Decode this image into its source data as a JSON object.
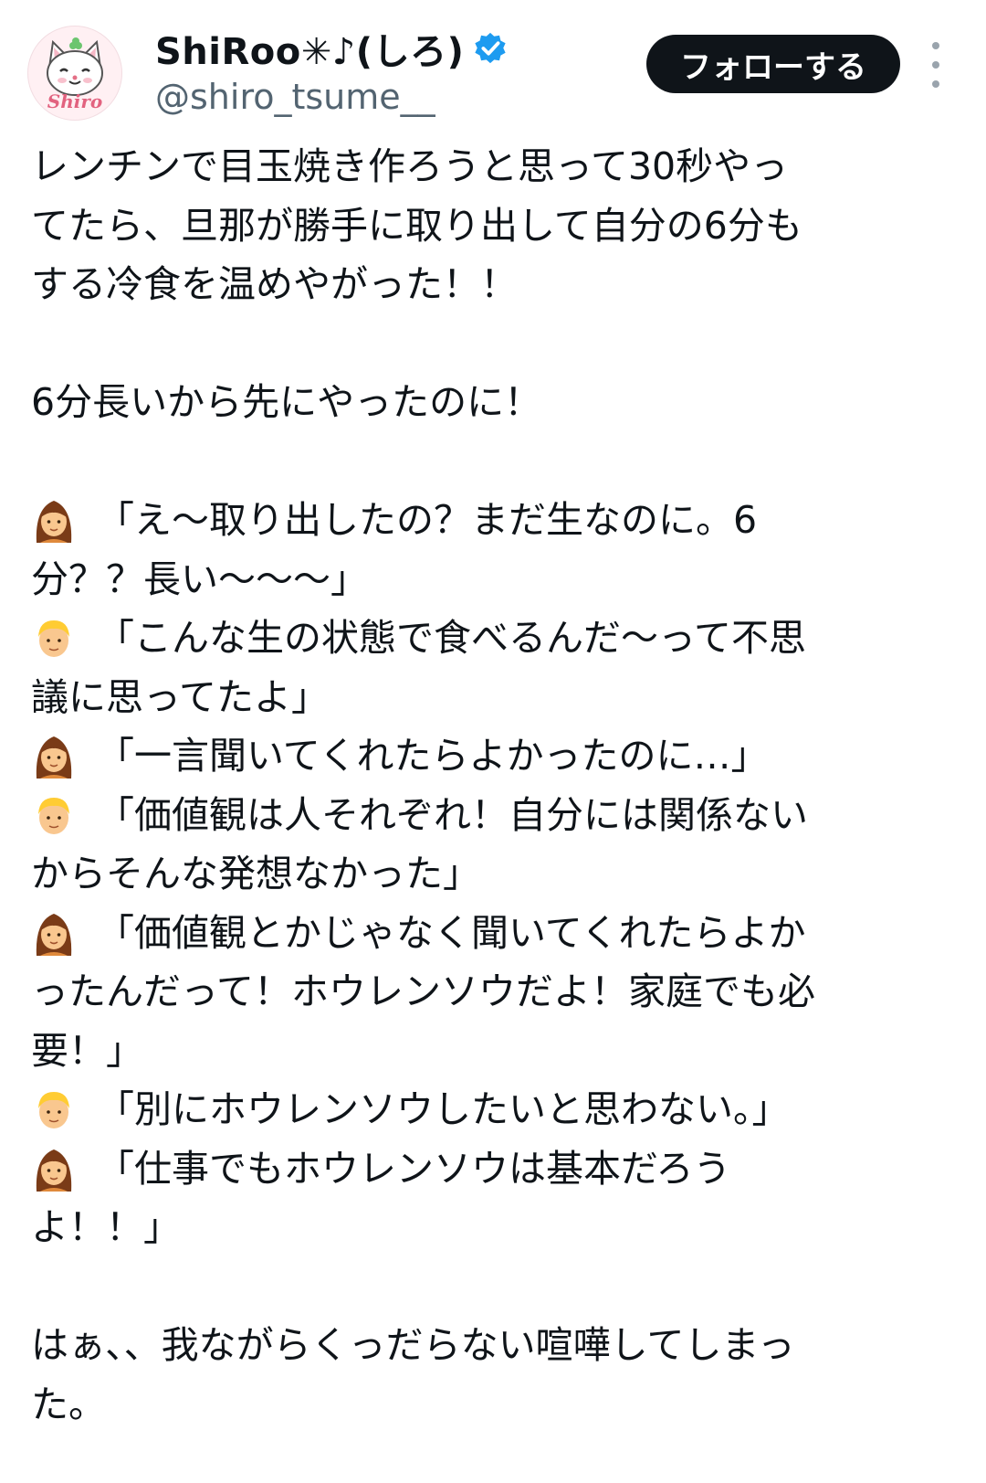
{
  "tweet": {
    "author": {
      "display_name": "ShiRoo✳♪(しろ)",
      "handle": "@shiro_tsume__",
      "avatar_text": "Shiro",
      "verified": true
    },
    "follow_label": "フォローする",
    "lines": [
      {
        "text": "レンチンで目玉焼き作ろうと思って30秒やっ"
      },
      {
        "text": "てたら、旦那が勝手に取り出して自分の6分も"
      },
      {
        "text": "する冷食を温めやがった！！"
      },
      {
        "text": ""
      },
      {
        "text": "6分長いから先にやったのに！"
      },
      {
        "text": ""
      },
      {
        "icon": "woman-emoji",
        "text": "「え〜取り出したの？まだ生なのに。6"
      },
      {
        "text": "分？？長い〜〜〜」"
      },
      {
        "icon": "man-emoji",
        "text": "「こんな生の状態で食べるんだ〜って不思"
      },
      {
        "text": "議に思ってたよ」"
      },
      {
        "icon": "woman-emoji",
        "text": "「一言聞いてくれたらよかったのに…」"
      },
      {
        "icon": "man-emoji",
        "text": "「価値観は人それぞれ！自分には関係ない"
      },
      {
        "text": "からそんな発想なかった」"
      },
      {
        "icon": "woman-emoji",
        "text": "「価値観とかじゃなく聞いてくれたらよか"
      },
      {
        "text": "ったんだって！ホウレンソウだよ！家庭でも必"
      },
      {
        "text": "要！」"
      },
      {
        "icon": "man-emoji",
        "text": "「別にホウレンソウしたいと思わない。」"
      },
      {
        "icon": "woman-emoji",
        "text": "「仕事でもホウレンソウは基本だろう"
      },
      {
        "text": "よ！！」"
      },
      {
        "text": ""
      },
      {
        "text": "はぁ、、我ながらくっだらない喧嘩してしまっ"
      },
      {
        "text": "た。"
      }
    ]
  }
}
